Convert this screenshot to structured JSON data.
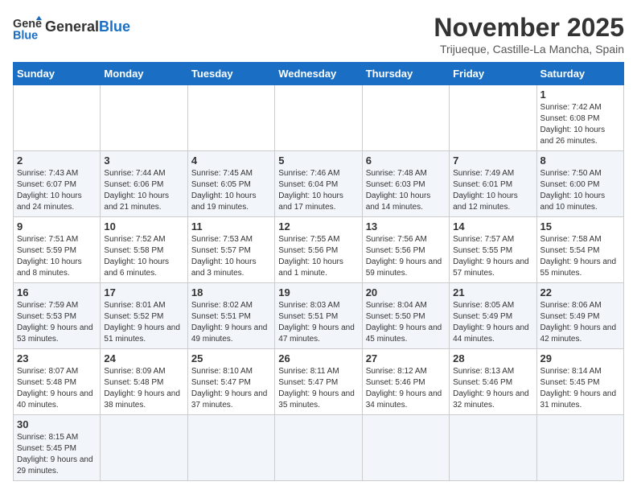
{
  "header": {
    "logo_general": "General",
    "logo_blue": "Blue",
    "title": "November 2025",
    "subtitle": "Trijueque, Castille-La Mancha, Spain"
  },
  "weekdays": [
    "Sunday",
    "Monday",
    "Tuesday",
    "Wednesday",
    "Thursday",
    "Friday",
    "Saturday"
  ],
  "weeks": [
    [
      {
        "day": "",
        "info": ""
      },
      {
        "day": "",
        "info": ""
      },
      {
        "day": "",
        "info": ""
      },
      {
        "day": "",
        "info": ""
      },
      {
        "day": "",
        "info": ""
      },
      {
        "day": "",
        "info": ""
      },
      {
        "day": "1",
        "info": "Sunrise: 7:42 AM\nSunset: 6:08 PM\nDaylight: 10 hours and 26 minutes."
      }
    ],
    [
      {
        "day": "2",
        "info": "Sunrise: 7:43 AM\nSunset: 6:07 PM\nDaylight: 10 hours and 24 minutes."
      },
      {
        "day": "3",
        "info": "Sunrise: 7:44 AM\nSunset: 6:06 PM\nDaylight: 10 hours and 21 minutes."
      },
      {
        "day": "4",
        "info": "Sunrise: 7:45 AM\nSunset: 6:05 PM\nDaylight: 10 hours and 19 minutes."
      },
      {
        "day": "5",
        "info": "Sunrise: 7:46 AM\nSunset: 6:04 PM\nDaylight: 10 hours and 17 minutes."
      },
      {
        "day": "6",
        "info": "Sunrise: 7:48 AM\nSunset: 6:03 PM\nDaylight: 10 hours and 14 minutes."
      },
      {
        "day": "7",
        "info": "Sunrise: 7:49 AM\nSunset: 6:01 PM\nDaylight: 10 hours and 12 minutes."
      },
      {
        "day": "8",
        "info": "Sunrise: 7:50 AM\nSunset: 6:00 PM\nDaylight: 10 hours and 10 minutes."
      }
    ],
    [
      {
        "day": "9",
        "info": "Sunrise: 7:51 AM\nSunset: 5:59 PM\nDaylight: 10 hours and 8 minutes."
      },
      {
        "day": "10",
        "info": "Sunrise: 7:52 AM\nSunset: 5:58 PM\nDaylight: 10 hours and 6 minutes."
      },
      {
        "day": "11",
        "info": "Sunrise: 7:53 AM\nSunset: 5:57 PM\nDaylight: 10 hours and 3 minutes."
      },
      {
        "day": "12",
        "info": "Sunrise: 7:55 AM\nSunset: 5:56 PM\nDaylight: 10 hours and 1 minute."
      },
      {
        "day": "13",
        "info": "Sunrise: 7:56 AM\nSunset: 5:56 PM\nDaylight: 9 hours and 59 minutes."
      },
      {
        "day": "14",
        "info": "Sunrise: 7:57 AM\nSunset: 5:55 PM\nDaylight: 9 hours and 57 minutes."
      },
      {
        "day": "15",
        "info": "Sunrise: 7:58 AM\nSunset: 5:54 PM\nDaylight: 9 hours and 55 minutes."
      }
    ],
    [
      {
        "day": "16",
        "info": "Sunrise: 7:59 AM\nSunset: 5:53 PM\nDaylight: 9 hours and 53 minutes."
      },
      {
        "day": "17",
        "info": "Sunrise: 8:01 AM\nSunset: 5:52 PM\nDaylight: 9 hours and 51 minutes."
      },
      {
        "day": "18",
        "info": "Sunrise: 8:02 AM\nSunset: 5:51 PM\nDaylight: 9 hours and 49 minutes."
      },
      {
        "day": "19",
        "info": "Sunrise: 8:03 AM\nSunset: 5:51 PM\nDaylight: 9 hours and 47 minutes."
      },
      {
        "day": "20",
        "info": "Sunrise: 8:04 AM\nSunset: 5:50 PM\nDaylight: 9 hours and 45 minutes."
      },
      {
        "day": "21",
        "info": "Sunrise: 8:05 AM\nSunset: 5:49 PM\nDaylight: 9 hours and 44 minutes."
      },
      {
        "day": "22",
        "info": "Sunrise: 8:06 AM\nSunset: 5:49 PM\nDaylight: 9 hours and 42 minutes."
      }
    ],
    [
      {
        "day": "23",
        "info": "Sunrise: 8:07 AM\nSunset: 5:48 PM\nDaylight: 9 hours and 40 minutes."
      },
      {
        "day": "24",
        "info": "Sunrise: 8:09 AM\nSunset: 5:48 PM\nDaylight: 9 hours and 38 minutes."
      },
      {
        "day": "25",
        "info": "Sunrise: 8:10 AM\nSunset: 5:47 PM\nDaylight: 9 hours and 37 minutes."
      },
      {
        "day": "26",
        "info": "Sunrise: 8:11 AM\nSunset: 5:47 PM\nDaylight: 9 hours and 35 minutes."
      },
      {
        "day": "27",
        "info": "Sunrise: 8:12 AM\nSunset: 5:46 PM\nDaylight: 9 hours and 34 minutes."
      },
      {
        "day": "28",
        "info": "Sunrise: 8:13 AM\nSunset: 5:46 PM\nDaylight: 9 hours and 32 minutes."
      },
      {
        "day": "29",
        "info": "Sunrise: 8:14 AM\nSunset: 5:45 PM\nDaylight: 9 hours and 31 minutes."
      }
    ],
    [
      {
        "day": "30",
        "info": "Sunrise: 8:15 AM\nSunset: 5:45 PM\nDaylight: 9 hours and 29 minutes."
      },
      {
        "day": "",
        "info": ""
      },
      {
        "day": "",
        "info": ""
      },
      {
        "day": "",
        "info": ""
      },
      {
        "day": "",
        "info": ""
      },
      {
        "day": "",
        "info": ""
      },
      {
        "day": "",
        "info": ""
      }
    ]
  ]
}
